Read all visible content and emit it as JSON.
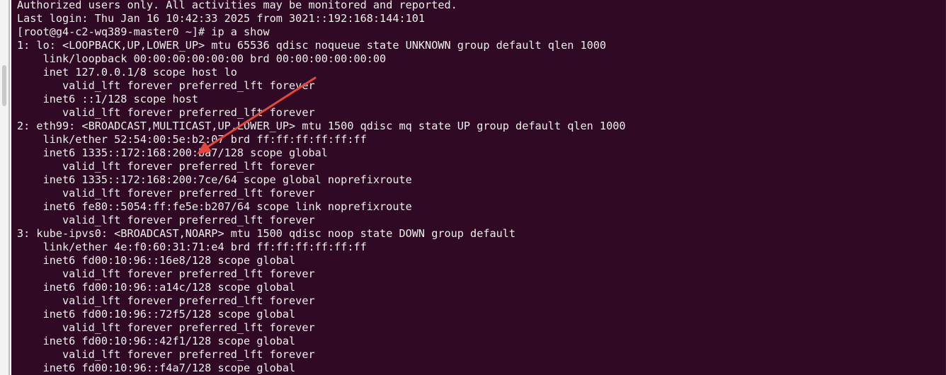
{
  "terminal": {
    "lines": [
      "Authorized users only. All activities may be monitored and reported.",
      "Last login: Thu Jan 16 10:42:33 2025 from 3021::192:168:144:101",
      "[root@g4-c2-wq389-master0 ~]# ip a show",
      "1: lo: <LOOPBACK,UP,LOWER_UP> mtu 65536 qdisc noqueue state UNKNOWN group default qlen 1000",
      "    link/loopback 00:00:00:00:00:00 brd 00:00:00:00:00:00",
      "    inet 127.0.0.1/8 scope host lo",
      "       valid_lft forever preferred_lft forever",
      "    inet6 ::1/128 scope host",
      "       valid_lft forever preferred_lft forever",
      "2: eth99: <BROADCAST,MULTICAST,UP,LOWER_UP> mtu 1500 qdisc mq state UP group default qlen 1000",
      "    link/ether 52:54:00:5e:b2:07 brd ff:ff:ff:ff:ff:ff",
      "    inet6 1335::172:168:200:ba7/128 scope global",
      "       valid_lft forever preferred_lft forever",
      "    inet6 1335::172:168:200:7ce/64 scope global noprefixroute",
      "       valid_lft forever preferred_lft forever",
      "    inet6 fe80::5054:ff:fe5e:b207/64 scope link noprefixroute",
      "       valid_lft forever preferred_lft forever",
      "3: kube-ipvs0: <BROADCAST,NOARP> mtu 1500 qdisc noop state DOWN group default",
      "    link/ether 4e:f0:60:31:71:e4 brd ff:ff:ff:ff:ff:ff",
      "    inet6 fd00:10:96::16e8/128 scope global",
      "       valid_lft forever preferred_lft forever",
      "    inet6 fd00:10:96::a14c/128 scope global",
      "       valid_lft forever preferred_lft forever",
      "    inet6 fd00:10:96::72f5/128 scope global",
      "       valid_lft forever preferred_lft forever",
      "    inet6 fd00:10:96::42f1/128 scope global",
      "       valid_lft forever preferred_lft forever",
      "    inet6 fd00:10:96::f4a7/128 scope global"
    ]
  },
  "colors": {
    "terminal_background": "#300a24",
    "terminal_text": "#eeeeec",
    "annotation_arrow": "#e8453c"
  }
}
